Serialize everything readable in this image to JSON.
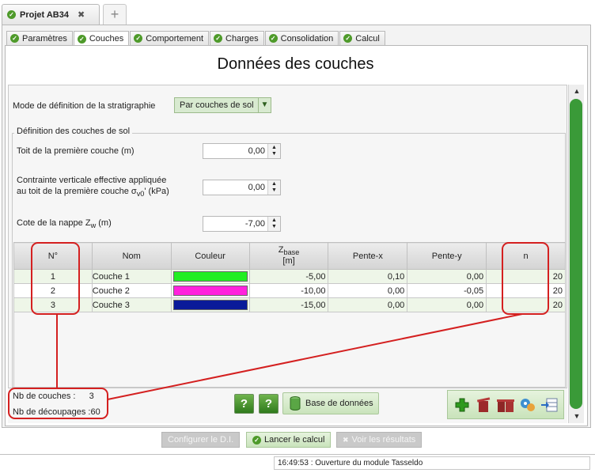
{
  "project_tab": {
    "label": "Projet AB34",
    "close": "✖"
  },
  "subtabs": [
    {
      "label": "Paramètres"
    },
    {
      "label": "Couches"
    },
    {
      "label": "Comportement"
    },
    {
      "label": "Charges"
    },
    {
      "label": "Consolidation"
    },
    {
      "label": "Calcul"
    }
  ],
  "page_title": "Données des couches",
  "mode": {
    "label": "Mode de définition de la stratigraphie",
    "value": "Par couches de sol"
  },
  "fieldset_label": "Définition des couches de sol",
  "fields": {
    "toit": {
      "label": "Toit de la première couche (m)",
      "value": "0,00"
    },
    "contrainte": {
      "label_line1": "Contrainte verticale effective appliquée",
      "label_line2_pre": "au toit de la première couche σ",
      "label_line2_sub": "v0",
      "label_line2_post": "' (kPa)",
      "value": "0,00"
    },
    "nappe": {
      "label_pre": "Cote de la nappe Z",
      "label_sub": "w",
      "label_post": " (m)",
      "value": "-7,00"
    }
  },
  "table": {
    "headers": {
      "num": "N°",
      "nom": "Nom",
      "couleur": "Couleur",
      "zbase_main": "Z",
      "zbase_sub": "base",
      "zbase_unit": "[m]",
      "pente_x": "Pente-x",
      "pente_y": "Pente-y",
      "n": "n"
    },
    "rows": [
      {
        "num": "1",
        "nom": "Couche 1",
        "color": "#22ee22",
        "zbase": "-5,00",
        "pente_x": "0,10",
        "pente_y": "0,00",
        "n": "20"
      },
      {
        "num": "2",
        "nom": "Couche 2",
        "color": "#ff22dd",
        "zbase": "-10,00",
        "pente_x": "0,00",
        "pente_y": "-0,05",
        "n": "20"
      },
      {
        "num": "3",
        "nom": "Couche 3",
        "color": "#0a1a99",
        "zbase": "-15,00",
        "pente_x": "0,00",
        "pente_y": "0,00",
        "n": "20"
      }
    ]
  },
  "summary": {
    "nb_couches_label": "Nb de couches :",
    "nb_couches": "3",
    "nb_decoupages_label": "Nb de découpages :",
    "nb_decoupages": "60"
  },
  "help_label": "?",
  "db_button": "Base de données",
  "actions": {
    "configurer": "Configurer le D.I.",
    "lancer": "Lancer le calcul",
    "voir": "Voir les résultats"
  },
  "status": "16:49:53 : Ouverture du module Tasseldo",
  "colors": {
    "accent": "#3a9a38",
    "annotation": "#d42020"
  }
}
